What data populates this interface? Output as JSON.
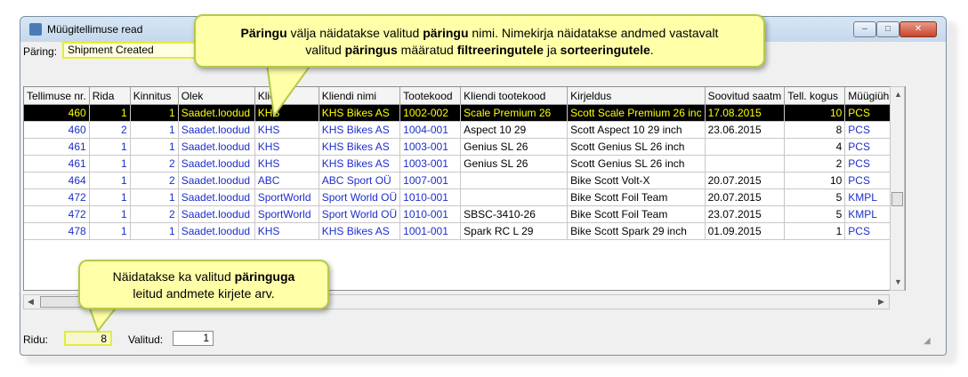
{
  "window": {
    "title": "Müügitellimuse read",
    "min_glyph": "–",
    "max_glyph": "□",
    "close_glyph": "✕"
  },
  "query": {
    "label": "Päring:",
    "value": "Shipment Created"
  },
  "table": {
    "columns": [
      "Tellimuse nr.",
      "Rida",
      "Kinnitus",
      "Olek",
      "Klient",
      "Kliendi nimi",
      "Tootekood",
      "Kliendi tootekood",
      "Kirjeldus",
      "Soovitud saatm",
      "Tell. kogus",
      "Müügiühik"
    ],
    "rows": [
      [
        "460",
        "1",
        "1",
        "Saadet.loodud",
        "KHS",
        "KHS Bikes AS",
        "1002-002",
        "Scale Premium 26",
        "Scott Scale Premium 26 inc",
        "17.08.2015",
        "10",
        "PCS"
      ],
      [
        "460",
        "2",
        "1",
        "Saadet.loodud",
        "KHS",
        "KHS Bikes AS",
        "1004-001",
        "Aspect 10 29",
        "Scott Aspect 10 29 inch",
        "23.06.2015",
        "8",
        "PCS"
      ],
      [
        "461",
        "1",
        "1",
        "Saadet.loodud",
        "KHS",
        "KHS Bikes AS",
        "1003-001",
        "Genius SL 26",
        "Scott Genius SL 26 inch",
        "",
        "4",
        "PCS"
      ],
      [
        "461",
        "1",
        "2",
        "Saadet.loodud",
        "KHS",
        "KHS Bikes AS",
        "1003-001",
        "Genius SL 26",
        "Scott Genius SL 26 inch",
        "",
        "2",
        "PCS"
      ],
      [
        "464",
        "1",
        "2",
        "Saadet.loodud",
        "ABC",
        "ABC Sport OÜ",
        "1007-001",
        "",
        "Bike Scott Volt-X",
        "20.07.2015",
        "10",
        "PCS"
      ],
      [
        "472",
        "1",
        "1",
        "Saadet.loodud",
        "SportWorld",
        "Sport World OÜ",
        "1010-001",
        "",
        "Bike Scott Foil Team",
        "20.07.2015",
        "5",
        "KMPL"
      ],
      [
        "472",
        "1",
        "2",
        "Saadet.loodud",
        "SportWorld",
        "Sport World OÜ",
        "1010-001",
        "SBSC-3410-26",
        "Bike Scott Foil Team",
        "23.07.2015",
        "5",
        "KMPL"
      ],
      [
        "478",
        "1",
        "1",
        "Saadet.loodud",
        "KHS",
        "KHS Bikes AS",
        "1001-001",
        "Spark RC L 29",
        "Bike Scott Spark 29 inch",
        "01.09.2015",
        "1",
        "PCS"
      ]
    ]
  },
  "status": {
    "rows_label": "Ridu:",
    "rows_value": "8",
    "selected_label": "Valitud:",
    "selected_value": "1"
  },
  "callout_top": {
    "p1": "Päringu",
    "p2": " välja näidatakse valitud ",
    "p3": "päringu",
    "p4": " nimi. Nimekirja näidatakse andmed vastavalt",
    "p5": "valitud ",
    "p6": "päringus",
    "p7": " määratud ",
    "p8": "filtreeringutele",
    "p9": " ja ",
    "p10": "sorteeringutele",
    "p11": "."
  },
  "callout_bottom": {
    "p1": "Näidatakse ka valitud ",
    "p2": "päringuga",
    "p3": "leitud andmete kirjete arv."
  },
  "colors": {
    "highlight": "#e4ec3a",
    "callout_bg": "#ffffa8",
    "link_blue": "#1d2dcc",
    "selection_fg": "#ffff00"
  }
}
